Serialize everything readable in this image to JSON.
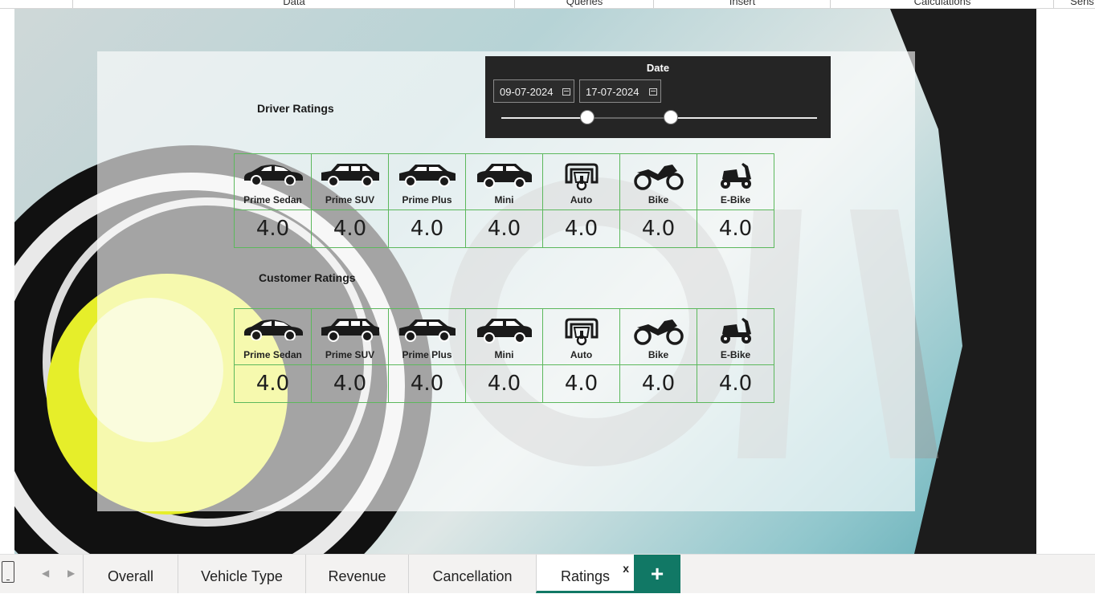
{
  "ribbon": {
    "groups": [
      "Data",
      "Queries",
      "Insert",
      "Calculations",
      "Sens"
    ]
  },
  "slicer": {
    "label": "Date",
    "start_date": "09-07-2024",
    "end_date": "17-07-2024"
  },
  "driver_ratings": {
    "title": "Driver Ratings",
    "items": [
      {
        "name": "Prime Sedan",
        "value": "4.0",
        "icon": "sedan-icon"
      },
      {
        "name": "Prime SUV",
        "value": "4.0",
        "icon": "suv-icon"
      },
      {
        "name": "Prime Plus",
        "value": "4.0",
        "icon": "prime-plus-icon"
      },
      {
        "name": "Mini",
        "value": "4.0",
        "icon": "mini-car-icon"
      },
      {
        "name": "Auto",
        "value": "4.0",
        "icon": "auto-rickshaw-icon"
      },
      {
        "name": "Bike",
        "value": "4.0",
        "icon": "motorbike-icon"
      },
      {
        "name": "E-Bike",
        "value": "4.0",
        "icon": "scooter-icon"
      }
    ]
  },
  "customer_ratings": {
    "title": "Customer Ratings",
    "items": [
      {
        "name": "Prime Sedan",
        "value": "4.0",
        "icon": "sedan-icon"
      },
      {
        "name": "Prime SUV",
        "value": "4.0",
        "icon": "suv-icon"
      },
      {
        "name": "Prime Plus",
        "value": "4.0",
        "icon": "prime-plus-icon"
      },
      {
        "name": "Mini",
        "value": "4.0",
        "icon": "mini-car-icon"
      },
      {
        "name": "Auto",
        "value": "4.0",
        "icon": "auto-rickshaw-icon"
      },
      {
        "name": "Bike",
        "value": "4.0",
        "icon": "motorbike-icon"
      },
      {
        "name": "E-Bike",
        "value": "4.0",
        "icon": "scooter-icon"
      }
    ]
  },
  "tabs": {
    "items": [
      "Overall",
      "Vehicle Type",
      "Revenue",
      "Cancellation",
      "Ratings"
    ],
    "active": "Ratings",
    "close_label": "x",
    "add_label": "+"
  },
  "colors": {
    "accent": "#117865",
    "grid_border": "#5cb85c",
    "slicer_bg": "#252525"
  }
}
